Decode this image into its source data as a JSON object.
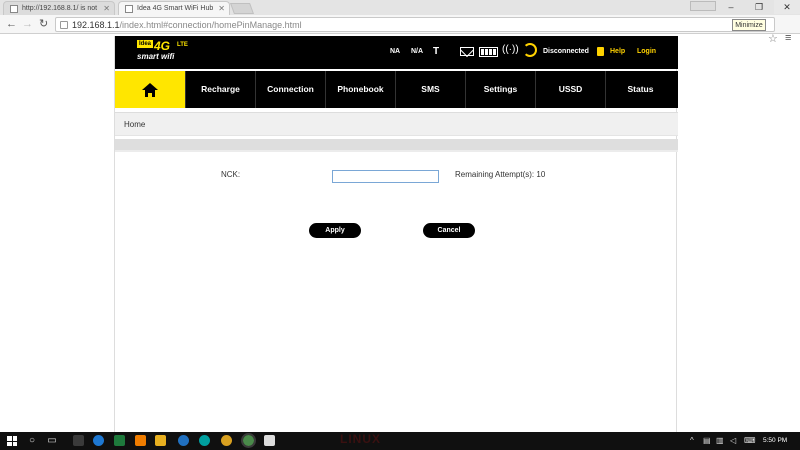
{
  "browser": {
    "tabs": [
      {
        "title": "http://192.168.8.1/ is not"
      },
      {
        "title": "Idea 4G Smart WiFi Hub"
      }
    ],
    "url_host": "192.168.1.1",
    "url_path": "/index.html#connection/homePinManage.html",
    "tooltip": "Minimize"
  },
  "header": {
    "logo_idea": "Idea",
    "logo_4g": "4G",
    "logo_lte": "LTE",
    "logo_smart": "smart wifi",
    "network": "NA",
    "network_type": "N/A",
    "connection_status": "Disconnected",
    "help": "Help",
    "login": "Login"
  },
  "nav": {
    "items": [
      "Recharge",
      "Connection",
      "Phonebook",
      "SMS",
      "Settings",
      "USSD",
      "Status"
    ]
  },
  "breadcrumb": "Home",
  "form": {
    "nck_label": "NCK:",
    "nck_value": "",
    "remaining": "Remaining Attempt(s): 10",
    "apply": "Apply",
    "cancel": "Cancel"
  },
  "taskbar": {
    "watermark": "LINUX",
    "time": "5:50 PM"
  },
  "colors": {
    "brand_yellow": "#ffe600",
    "accent_yellow": "#ffd200",
    "header_black": "#000000"
  }
}
